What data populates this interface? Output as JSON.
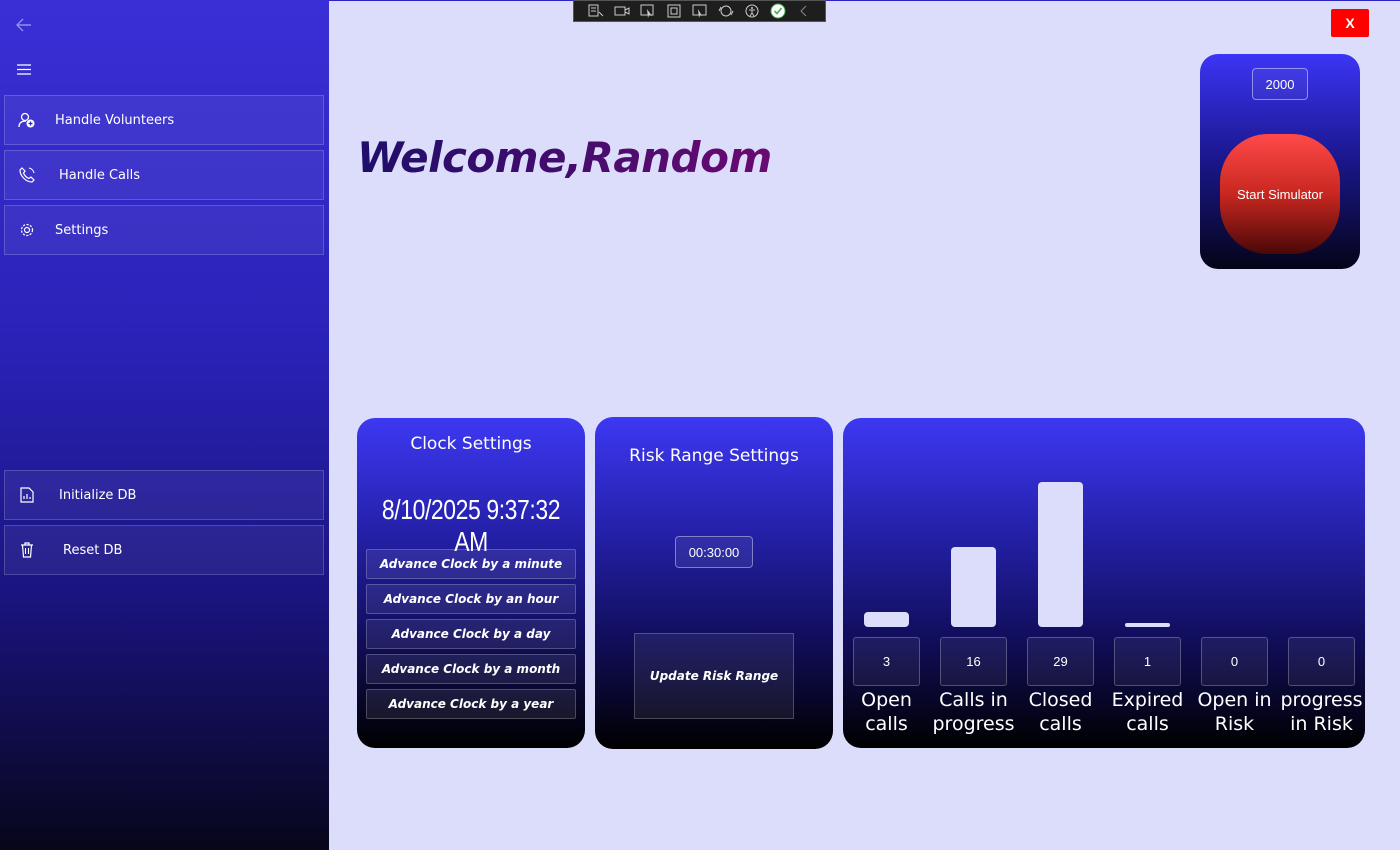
{
  "sidebar": {
    "items": [
      {
        "label": "Handle Volunteers",
        "icon": "add-person-icon"
      },
      {
        "label": "Handle Calls",
        "icon": "phone-icon"
      },
      {
        "label": "Settings",
        "icon": "gear-icon"
      }
    ],
    "bottom_items": [
      {
        "label": "Initialize DB",
        "icon": "document-chart-icon"
      },
      {
        "label": "Reset DB",
        "icon": "trash-icon"
      }
    ]
  },
  "header": {
    "welcome": "Welcome,Random",
    "close_label": "X"
  },
  "simulator": {
    "interval": "2000",
    "button_label": "Start Simulator"
  },
  "clock": {
    "title": "Clock Settings",
    "time": "8/10/2025 9:37:32 AM",
    "buttons": [
      "Advance Clock by a minute",
      "Advance Clock by an hour",
      "Advance Clock by a day",
      "Advance Clock by a month",
      "Advance Clock by a year"
    ]
  },
  "risk": {
    "title": "Risk Range Settings",
    "value": "00:30:00",
    "update_label": "Update Risk Range"
  },
  "stats": [
    {
      "value": "3",
      "count": 3,
      "label_line1": "Open",
      "label_line2": "calls"
    },
    {
      "value": "16",
      "count": 16,
      "label_line1": "Calls in",
      "label_line2": "progress"
    },
    {
      "value": "29",
      "count": 29,
      "label_line1": "Closed",
      "label_line2": "calls"
    },
    {
      "value": "1",
      "count": 1,
      "label_line1": "Expired",
      "label_line2": "calls"
    },
    {
      "value": "0",
      "count": 0,
      "label_line1": "Open in",
      "label_line2": "Risk"
    },
    {
      "value": "0",
      "count": 0,
      "label_line1": "progress",
      "label_line2": "in Risk"
    }
  ],
  "colors": {
    "accent": "#3d38f2",
    "close": "#ff0000",
    "simulator": "#e03a30",
    "background": "#dcdcfb"
  }
}
